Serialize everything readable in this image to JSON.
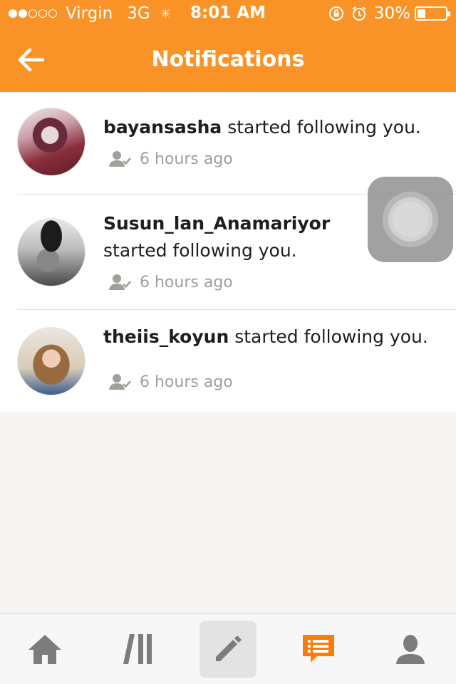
{
  "status_bar": {
    "signal_filled": 2,
    "signal_total": 5,
    "carrier": "Virgin",
    "network": "3G",
    "time": "8:01 AM",
    "battery": "30%",
    "battery_level": 0.3
  },
  "header": {
    "title": "Notifications",
    "back_icon": "arrow-left-icon",
    "color": "#fa9327"
  },
  "notifications": [
    {
      "username": "bayansasha",
      "action": "started following you.",
      "time": "6 hours ago",
      "icon": "user-check-icon"
    },
    {
      "username": "Susun_lan_Anamariyor",
      "action": "started following you.",
      "time": "6 hours ago",
      "icon": "user-check-icon"
    },
    {
      "username": "theiis_koyun",
      "action": "started following you.",
      "time": "6 hours ago",
      "icon": "user-check-icon"
    }
  ],
  "tabbar": {
    "tabs": [
      {
        "icon": "home-icon"
      },
      {
        "icon": "library-icon"
      },
      {
        "icon": "pencil-icon",
        "active": true
      },
      {
        "icon": "chat-list-icon",
        "color": "#fa7d0a"
      },
      {
        "icon": "profile-icon"
      }
    ]
  }
}
